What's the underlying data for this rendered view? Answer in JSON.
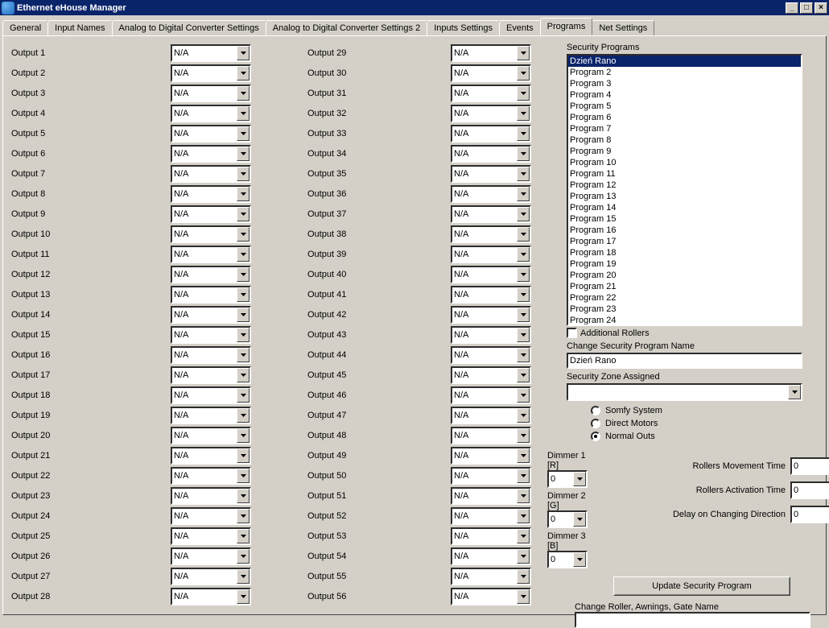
{
  "window": {
    "title": "Ethernet eHouse Manager"
  },
  "tabs": [
    "General",
    "Input Names",
    "Analog to Digital Converter Settings",
    "Analog to Digital Converter Settings 2",
    "Inputs Settings",
    "Events",
    "Programs",
    "Net Settings"
  ],
  "active_tab": 6,
  "outputs_left": [
    {
      "label": "Output 1",
      "value": "N/A"
    },
    {
      "label": "Output 2",
      "value": "N/A"
    },
    {
      "label": "Output 3",
      "value": "N/A"
    },
    {
      "label": "Output 4",
      "value": "N/A"
    },
    {
      "label": "Output 5",
      "value": "N/A"
    },
    {
      "label": "Output 6",
      "value": "N/A"
    },
    {
      "label": "Output 7",
      "value": "N/A"
    },
    {
      "label": "Output 8",
      "value": "N/A"
    },
    {
      "label": "Output 9",
      "value": "N/A"
    },
    {
      "label": "Output 10",
      "value": "N/A"
    },
    {
      "label": "Output 11",
      "value": "N/A"
    },
    {
      "label": "Output 12",
      "value": "N/A"
    },
    {
      "label": "Output 13",
      "value": "N/A"
    },
    {
      "label": "Output 14",
      "value": "N/A"
    },
    {
      "label": "Output 15",
      "value": "N/A"
    },
    {
      "label": "Output 16",
      "value": "N/A"
    },
    {
      "label": "Output 17",
      "value": "N/A"
    },
    {
      "label": "Output 18",
      "value": "N/A"
    },
    {
      "label": "Output 19",
      "value": "N/A"
    },
    {
      "label": "Output 20",
      "value": "N/A"
    },
    {
      "label": "Output 21",
      "value": "N/A"
    },
    {
      "label": "Output 22",
      "value": "N/A"
    },
    {
      "label": "Output 23",
      "value": "N/A"
    },
    {
      "label": "Output 24",
      "value": "N/A"
    },
    {
      "label": "Output 25",
      "value": "N/A"
    },
    {
      "label": "Output 26",
      "value": "N/A"
    },
    {
      "label": "Output 27",
      "value": "N/A"
    },
    {
      "label": "Output 28",
      "value": "N/A"
    }
  ],
  "outputs_right": [
    {
      "label": "Output 29",
      "value": "N/A"
    },
    {
      "label": "Output 30",
      "value": "N/A"
    },
    {
      "label": "Output 31",
      "value": "N/A"
    },
    {
      "label": "Output 32",
      "value": "N/A"
    },
    {
      "label": "Output 33",
      "value": "N/A"
    },
    {
      "label": "Output 34",
      "value": "N/A"
    },
    {
      "label": "Output 35",
      "value": "N/A"
    },
    {
      "label": "Output 36",
      "value": "N/A"
    },
    {
      "label": "Output 37",
      "value": "N/A"
    },
    {
      "label": "Output 38",
      "value": "N/A"
    },
    {
      "label": "Output 39",
      "value": "N/A"
    },
    {
      "label": "Output 40",
      "value": "N/A"
    },
    {
      "label": "Output 41",
      "value": "N/A"
    },
    {
      "label": "Output 42",
      "value": "N/A"
    },
    {
      "label": "Output 43",
      "value": "N/A"
    },
    {
      "label": "Output 44",
      "value": "N/A"
    },
    {
      "label": "Output 45",
      "value": "N/A"
    },
    {
      "label": "Output 46",
      "value": "N/A"
    },
    {
      "label": "Output 47",
      "value": "N/A"
    },
    {
      "label": "Output 48",
      "value": "N/A"
    },
    {
      "label": "Output 49",
      "value": "N/A"
    },
    {
      "label": "Output 50",
      "value": "N/A"
    },
    {
      "label": "Output 51",
      "value": "N/A"
    },
    {
      "label": "Output 52",
      "value": "N/A"
    },
    {
      "label": "Output 53",
      "value": "N/A"
    },
    {
      "label": "Output 54",
      "value": "N/A"
    },
    {
      "label": "Output 55",
      "value": "N/A"
    },
    {
      "label": "Output 56",
      "value": "N/A"
    }
  ],
  "security": {
    "label": "Security Programs",
    "programs": [
      "Dzień Rano",
      "Program 2",
      "Program 3",
      "Program 4",
      "Program 5",
      "Program 6",
      "Program 7",
      "Program 8",
      "Program 9",
      "Program 10",
      "Program 11",
      "Program 12",
      "Program 13",
      "Program 14",
      "Program 15",
      "Program 16",
      "Program 17",
      "Program 18",
      "Program 19",
      "Program 20",
      "Program 21",
      "Program 22",
      "Program 23",
      "Program 24"
    ],
    "selected": 0,
    "additional_rollers_label": "Additional Rollers",
    "change_name_label": "Change Security Program Name",
    "change_name_value": "Dzień Rano",
    "zone_label": "Security Zone Assigned",
    "zone_value": "",
    "radios": {
      "somfy": "Somfy System",
      "direct": "Direct Motors",
      "normal": "Normal Outs"
    },
    "radio_selected": "normal"
  },
  "dimmers": {
    "d1_label": "Dimmer 1 [R]",
    "d1_value": "0",
    "d2_label": "Dimmer 2 [G]",
    "d2_value": "0",
    "d3_label": "Dimmer 3 [B]",
    "d3_value": "0"
  },
  "rollers": {
    "move_label": "Rollers Movement Time",
    "move_value": "0",
    "act_label": "Rollers Activation Time",
    "act_value": "0",
    "delay_label": "Delay on Changing Direction",
    "delay_value": "0"
  },
  "update_button": "Update Security Program",
  "change_roller_label": "Change Roller, Awnings, Gate Name",
  "change_roller_value": ""
}
